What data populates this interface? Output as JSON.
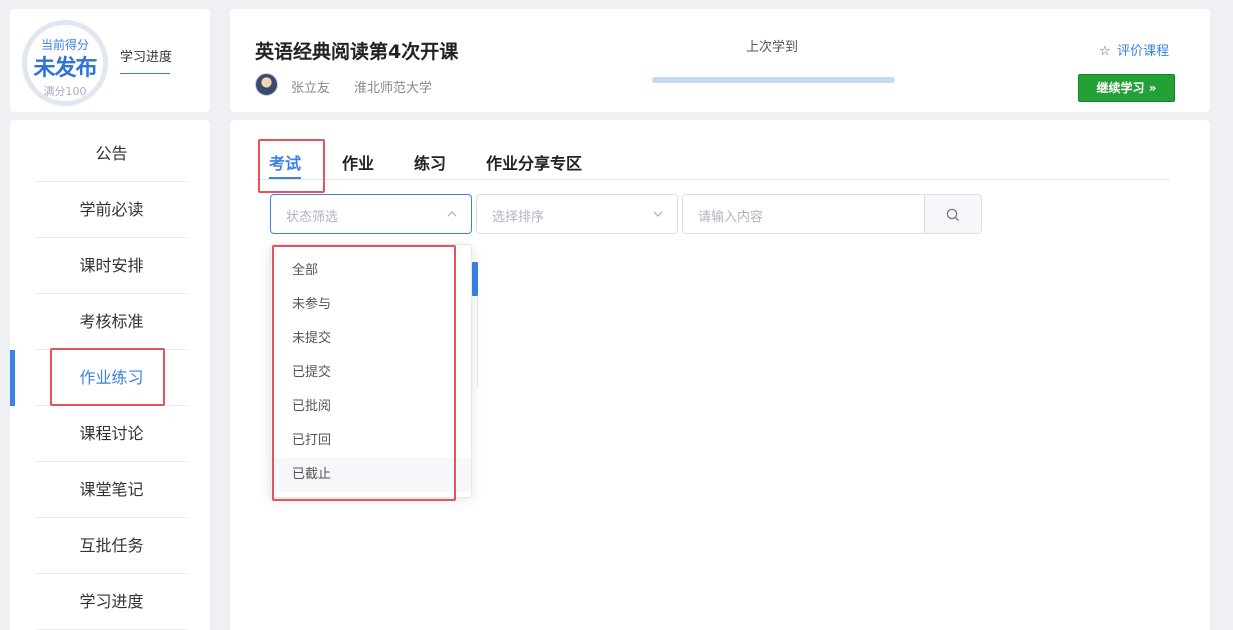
{
  "score": {
    "top_label": "当前得分",
    "status": "未发布",
    "full_label": "满分100",
    "progress_link": "学习进度"
  },
  "sidebar": {
    "items": [
      {
        "label": "公告"
      },
      {
        "label": "学前必读"
      },
      {
        "label": "课时安排"
      },
      {
        "label": "考核标准"
      },
      {
        "label": "作业练习"
      },
      {
        "label": "课程讨论"
      },
      {
        "label": "课堂笔记"
      },
      {
        "label": "互批任务"
      },
      {
        "label": "学习进度"
      }
    ],
    "active_index": 4
  },
  "header": {
    "title": "英语经典阅读第4次开课",
    "teacher": "张立友",
    "school": "淮北师范大学",
    "last_learn_label": "上次学到",
    "rate_label": "评价课程",
    "continue_label": "继续学习 »"
  },
  "tabs": [
    {
      "label": "考试"
    },
    {
      "label": "作业"
    },
    {
      "label": "练习"
    },
    {
      "label": "作业分享专区"
    }
  ],
  "filters": {
    "status_placeholder": "状态筛选",
    "sort_placeholder": "选择排序",
    "search_placeholder": "请输入内容"
  },
  "dropdown": {
    "options": [
      "全部",
      "未参与",
      "未提交",
      "已提交",
      "已批阅",
      "已打回",
      "已截止"
    ]
  },
  "colors": {
    "accent": "#3b82e6",
    "continue_button": "#23a136",
    "highlight_box": "#e5535d"
  },
  "icons": {
    "rate": "star-icon",
    "search": "search-icon",
    "select_open": "chevron-up-icon",
    "select_closed": "chevron-down-icon"
  }
}
